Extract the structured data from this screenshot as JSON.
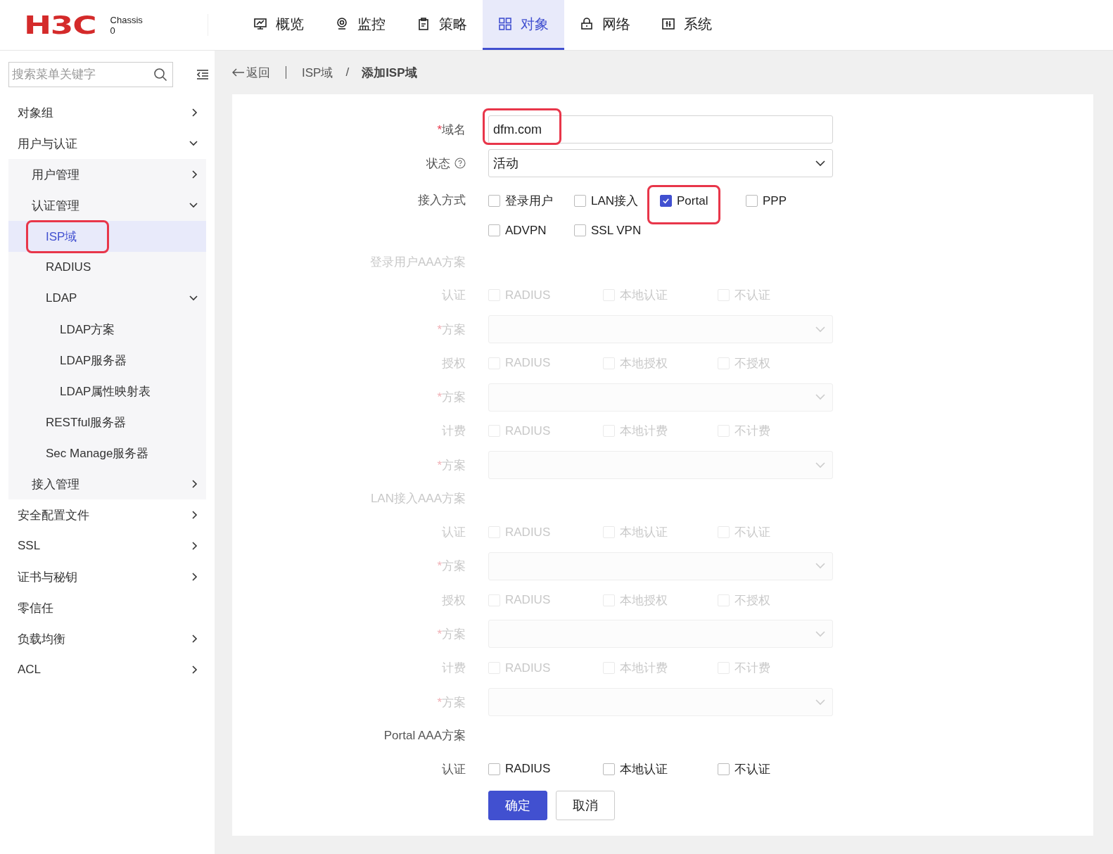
{
  "header": {
    "logo": "H3C",
    "device": "Chassis",
    "device_id": "0",
    "nav": [
      {
        "label": "概览",
        "selected": false
      },
      {
        "label": "监控",
        "selected": false
      },
      {
        "label": "策略",
        "selected": false
      },
      {
        "label": "对象",
        "selected": true
      },
      {
        "label": "网络",
        "selected": false
      },
      {
        "label": "系统",
        "selected": false
      }
    ]
  },
  "sidebar": {
    "search": {
      "placeholder": "搜索菜单关键字"
    },
    "items": [
      {
        "label": "对象组",
        "selected": false,
        "expanded": false
      },
      {
        "label": "用户与认证",
        "selected": false,
        "expanded": true,
        "children": [
          {
            "label": "用户管理",
            "selected": false,
            "expanded": false
          },
          {
            "label": "认证管理",
            "selected": false,
            "expanded": true,
            "children": [
              {
                "label": "ISP域",
                "selected": true,
                "highlighted": true
              },
              {
                "label": "RADIUS",
                "selected": false
              },
              {
                "label": "LDAP",
                "selected": false,
                "expanded": true,
                "children": [
                  {
                    "label": "LDAP方案",
                    "selected": false
                  },
                  {
                    "label": "LDAP服务器",
                    "selected": false
                  },
                  {
                    "label": "LDAP属性映射表",
                    "selected": false
                  }
                ]
              },
              {
                "label": "RESTful服务器",
                "selected": false
              },
              {
                "label": "Sec Manage服务器",
                "selected": false
              }
            ]
          },
          {
            "label": "接入管理",
            "selected": false,
            "expanded": false
          }
        ]
      },
      {
        "label": "安全配置文件",
        "selected": false,
        "expanded": false
      },
      {
        "label": "SSL",
        "selected": false,
        "expanded": false
      },
      {
        "label": "证书与秘钥",
        "selected": false,
        "expanded": false
      },
      {
        "label": "零信任",
        "selected": false
      },
      {
        "label": "负载均衡",
        "selected": false,
        "expanded": false
      },
      {
        "label": "ACL",
        "selected": false,
        "expanded": false
      }
    ]
  },
  "breadcrumb": {
    "back": "返回",
    "items": [
      "ISP域",
      "添加ISP域"
    ],
    "separator": "/"
  },
  "form": {
    "domain": {
      "label": "域名",
      "required_mark": "*",
      "value": "dfm.com",
      "highlighted": true
    },
    "status": {
      "label": "状态",
      "value": "活动"
    },
    "access": {
      "label": "接入方式",
      "options": [
        {
          "label": "登录用户",
          "checked": false,
          "highlighted": false
        },
        {
          "label": "LAN接入",
          "checked": false,
          "highlighted": false
        },
        {
          "label": "Portal",
          "checked": true,
          "highlighted": true
        },
        {
          "label": "PPP",
          "checked": false,
          "highlighted": false
        },
        {
          "label": "ADVPN",
          "checked": false,
          "highlighted": false
        },
        {
          "label": "SSL VPN",
          "checked": false,
          "highlighted": false
        }
      ]
    },
    "sections": [
      {
        "title": "登录用户AAA方案",
        "disabled": true,
        "rows": [
          {
            "kind": "checks",
            "label": "认证",
            "options": [
              {
                "label": "RADIUS",
                "checked": false
              },
              {
                "label": "本地认证",
                "checked": false
              },
              {
                "label": "不认证",
                "checked": false
              }
            ]
          },
          {
            "kind": "select",
            "label": "方案",
            "required_mark": "*"
          },
          {
            "kind": "checks",
            "label": "授权",
            "options": [
              {
                "label": "RADIUS",
                "checked": false
              },
              {
                "label": "本地授权",
                "checked": false
              },
              {
                "label": "不授权",
                "checked": false
              }
            ]
          },
          {
            "kind": "select",
            "label": "方案",
            "required_mark": "*"
          },
          {
            "kind": "checks",
            "label": "计费",
            "options": [
              {
                "label": "RADIUS",
                "checked": false
              },
              {
                "label": "本地计费",
                "checked": false
              },
              {
                "label": "不计费",
                "checked": false
              }
            ]
          },
          {
            "kind": "select",
            "label": "方案",
            "required_mark": "*"
          }
        ]
      },
      {
        "title": "LAN接入AAA方案",
        "disabled": true,
        "rows": [
          {
            "kind": "checks",
            "label": "认证",
            "options": [
              {
                "label": "RADIUS",
                "checked": false
              },
              {
                "label": "本地认证",
                "checked": false
              },
              {
                "label": "不认证",
                "checked": false
              }
            ]
          },
          {
            "kind": "select",
            "label": "方案",
            "required_mark": "*"
          },
          {
            "kind": "checks",
            "label": "授权",
            "options": [
              {
                "label": "RADIUS",
                "checked": false
              },
              {
                "label": "本地授权",
                "checked": false
              },
              {
                "label": "不授权",
                "checked": false
              }
            ]
          },
          {
            "kind": "select",
            "label": "方案",
            "required_mark": "*"
          },
          {
            "kind": "checks",
            "label": "计费",
            "options": [
              {
                "label": "RADIUS",
                "checked": false
              },
              {
                "label": "本地计费",
                "checked": false
              },
              {
                "label": "不计费",
                "checked": false
              }
            ]
          },
          {
            "kind": "select",
            "label": "方案",
            "required_mark": "*"
          }
        ]
      },
      {
        "title": "Portal AAA方案",
        "disabled": false,
        "rows": [
          {
            "kind": "checks",
            "label": "认证",
            "options": [
              {
                "label": "RADIUS",
                "checked": false
              },
              {
                "label": "本地认证",
                "checked": false
              },
              {
                "label": "不认证",
                "checked": false
              }
            ]
          }
        ]
      }
    ]
  },
  "buttons": [
    {
      "label": "确定",
      "kind": "primary"
    },
    {
      "label": "取消",
      "kind": "secondary"
    }
  ]
}
